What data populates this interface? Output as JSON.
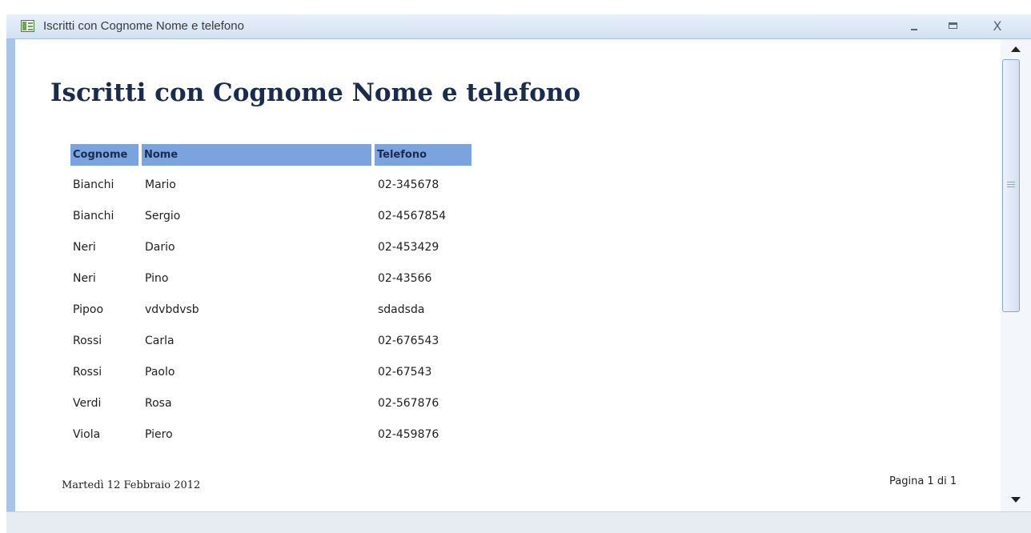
{
  "window": {
    "title": "Iscritti con Cognome Nome e telefono",
    "minimize_glyph": "_",
    "maximize_glyph": "□",
    "close_glyph": "X"
  },
  "report": {
    "title": "Iscritti con Cognome Nome e telefono",
    "headers": {
      "cognome": "Cognome",
      "nome": "Nome",
      "telefono": "Telefono"
    },
    "rows": [
      {
        "cognome": "Bianchi",
        "nome": "Mario",
        "telefono": "02-345678"
      },
      {
        "cognome": "Bianchi",
        "nome": "Sergio",
        "telefono": "02-4567854"
      },
      {
        "cognome": "Neri",
        "nome": "Dario",
        "telefono": "02-453429"
      },
      {
        "cognome": "Neri",
        "nome": "Pino",
        "telefono": "02-43566"
      },
      {
        "cognome": "Pipoo",
        "nome": "vdvbdvsb",
        "telefono": "sdadsda"
      },
      {
        "cognome": "Rossi",
        "nome": "Carla",
        "telefono": "02-676543"
      },
      {
        "cognome": "Rossi",
        "nome": "Paolo",
        "telefono": "02-67543"
      },
      {
        "cognome": "Verdi",
        "nome": "Rosa",
        "telefono": "02-567876"
      },
      {
        "cognome": "Viola",
        "nome": "Piero",
        "telefono": "02-459876"
      }
    ],
    "footer": {
      "date": "Martedì 12 Febbraio 2012",
      "page": "Pagina 1 di 1"
    }
  },
  "colors": {
    "header_fill": "#7ba3de",
    "title_text": "#1a2c4e",
    "frame_border": "#a9c4e8"
  },
  "icons": {
    "app": "access-report-icon",
    "scroll_up": "arrow-up-icon",
    "scroll_down": "arrow-down-icon"
  }
}
